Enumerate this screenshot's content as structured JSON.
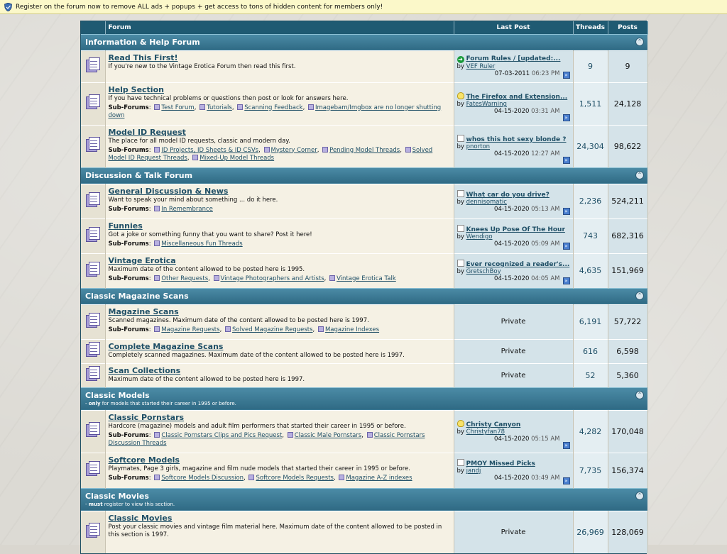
{
  "notice": "Register on the forum now to remove ALL ads + popups + get access to tons of hidden content for members only!",
  "header": {
    "forum": "Forum",
    "last_post": "Last Post",
    "threads": "Threads",
    "posts": "Posts"
  },
  "subforums_label": "Sub-Forums",
  "by_label": "by",
  "private_label": "Private",
  "categories": [
    {
      "title": "Information & Help Forum",
      "forums": [
        {
          "title": "Read This First!",
          "desc": "If you're new to the Vintage Erotica Forum then read this first.",
          "subs": [],
          "last": {
            "icon": "arrow",
            "title": "Forum Rules / [updated:...",
            "by": "VEF Ruler",
            "date": "07-03-2011",
            "time": "06:23 PM"
          },
          "threads": "9",
          "posts": "9"
        },
        {
          "title": "Help Section",
          "desc": "If you have technical problems or questions then post or look for answers here.",
          "subs": [
            "Test Forum",
            "Tutorials",
            "Scanning Feedback",
            "Imagebam/Imgbox are no longer shutting down"
          ],
          "last": {
            "icon": "bulb",
            "title": "The Firefox and Extension...",
            "by": "FatesWarning",
            "date": "04-15-2020",
            "time": "03:31 AM"
          },
          "threads": "1,511",
          "posts": "24,128"
        },
        {
          "title": "Model ID Request",
          "desc": "The place for all model ID requests, classic and modern day.",
          "subs": [
            "ID Projects, ID Sheets & ID CSVs",
            "Mystery Corner",
            "Pending Model Threads",
            "Solved Model ID Request Threads",
            "Mixed-Up Model Threads"
          ],
          "last": {
            "icon": "doc",
            "title": "whos this hot sexy blonde ?",
            "by": "pnorton",
            "date": "04-15-2020",
            "time": "12:27 AM"
          },
          "threads": "24,304",
          "posts": "98,622"
        }
      ]
    },
    {
      "title": "Discussion & Talk Forum",
      "forums": [
        {
          "title": "General Discussion & News",
          "desc": "Want to speak your mind about something ... do it here.",
          "subs": [
            "In Remembrance"
          ],
          "last": {
            "icon": "doc",
            "title": "What car do you drive?",
            "by": "dennisomatic",
            "date": "04-15-2020",
            "time": "05:13 AM"
          },
          "threads": "2,236",
          "posts": "524,211"
        },
        {
          "title": "Funnies",
          "desc": "Got a joke or something funny that you want to share? Post it here!",
          "subs": [
            "Miscellaneous Fun Threads"
          ],
          "last": {
            "icon": "doc",
            "title": "Knees Up Pose Of The Hour",
            "by": "Wendigo",
            "date": "04-15-2020",
            "time": "05:09 AM"
          },
          "threads": "743",
          "posts": "682,316"
        },
        {
          "title": "Vintage Erotica",
          "desc": "Maximum date of the content allowed to be posted here is 1995.",
          "subs": [
            "Other Requests",
            "Vintage Photographers and Artists",
            "Vintage Erotica Talk"
          ],
          "last": {
            "icon": "doc",
            "title": "Ever recognized a reader's...",
            "by": "GretschBoy",
            "date": "04-15-2020",
            "time": "04:05 AM"
          },
          "threads": "4,635",
          "posts": "151,969"
        }
      ]
    },
    {
      "title": "Classic Magazine Scans",
      "forums": [
        {
          "title": "Magazine Scans",
          "desc": "Scanned magazines. Maximum date of the content allowed to be posted here is 1997.",
          "subs": [
            "Magazine Requests",
            "Solved Magazine Requests",
            "Magazine Indexes"
          ],
          "last": null,
          "threads": "6,191",
          "posts": "57,722"
        },
        {
          "title": "Complete Magazine Scans",
          "desc": "Completely scanned magazines. Maximum date of the content allowed to be posted here is 1997.",
          "subs": [],
          "last": null,
          "threads": "616",
          "posts": "6,598"
        },
        {
          "title": "Scan Collections",
          "desc": "Maximum date of the content allowed to be posted here is 1997.",
          "subs": [],
          "last": null,
          "threads": "52",
          "posts": "5,360"
        }
      ]
    },
    {
      "title": "Classic Models",
      "sub_bold": "only",
      "sub_rest": " for models that started their career in 1995 or before.",
      "forums": [
        {
          "title": "Classic Pornstars",
          "desc": "Hardcore (magazine) models and adult film performers that started their career in 1995 or before.",
          "subs": [
            "Classic Pornstars Clips and Pics Request",
            "Classic Male Pornstars",
            "Classic Pornstars Discussion Threads"
          ],
          "last": {
            "icon": "bulb",
            "title": "Christy Canyon",
            "by": "Christyfan78",
            "date": "04-15-2020",
            "time": "05:15 AM"
          },
          "threads": "4,282",
          "posts": "170,048"
        },
        {
          "title": "Softcore Models",
          "desc": "Playmates, Page 3 girls, magazine and film nude models that started their career in 1995 or before.",
          "subs": [
            "Softcore Models Discussion",
            "Softcore Models Requests",
            "Magazine A-Z indexes"
          ],
          "last": {
            "icon": "doc",
            "title": "PMOY Missed Picks",
            "by": "jandj",
            "date": "04-15-2020",
            "time": "03:49 AM"
          },
          "threads": "7,735",
          "posts": "156,374"
        }
      ]
    },
    {
      "title": "Classic Movies",
      "sub_bold": "must",
      "sub_rest": " register to view this section.",
      "forums": [
        {
          "title": "Classic Movies",
          "desc": "Post your classic movies and vintage film material here. Maximum date of the content allowed to be posted in this section is 1997.",
          "subs": [],
          "last": null,
          "threads": "26,969",
          "posts": "128,069"
        }
      ]
    }
  ]
}
